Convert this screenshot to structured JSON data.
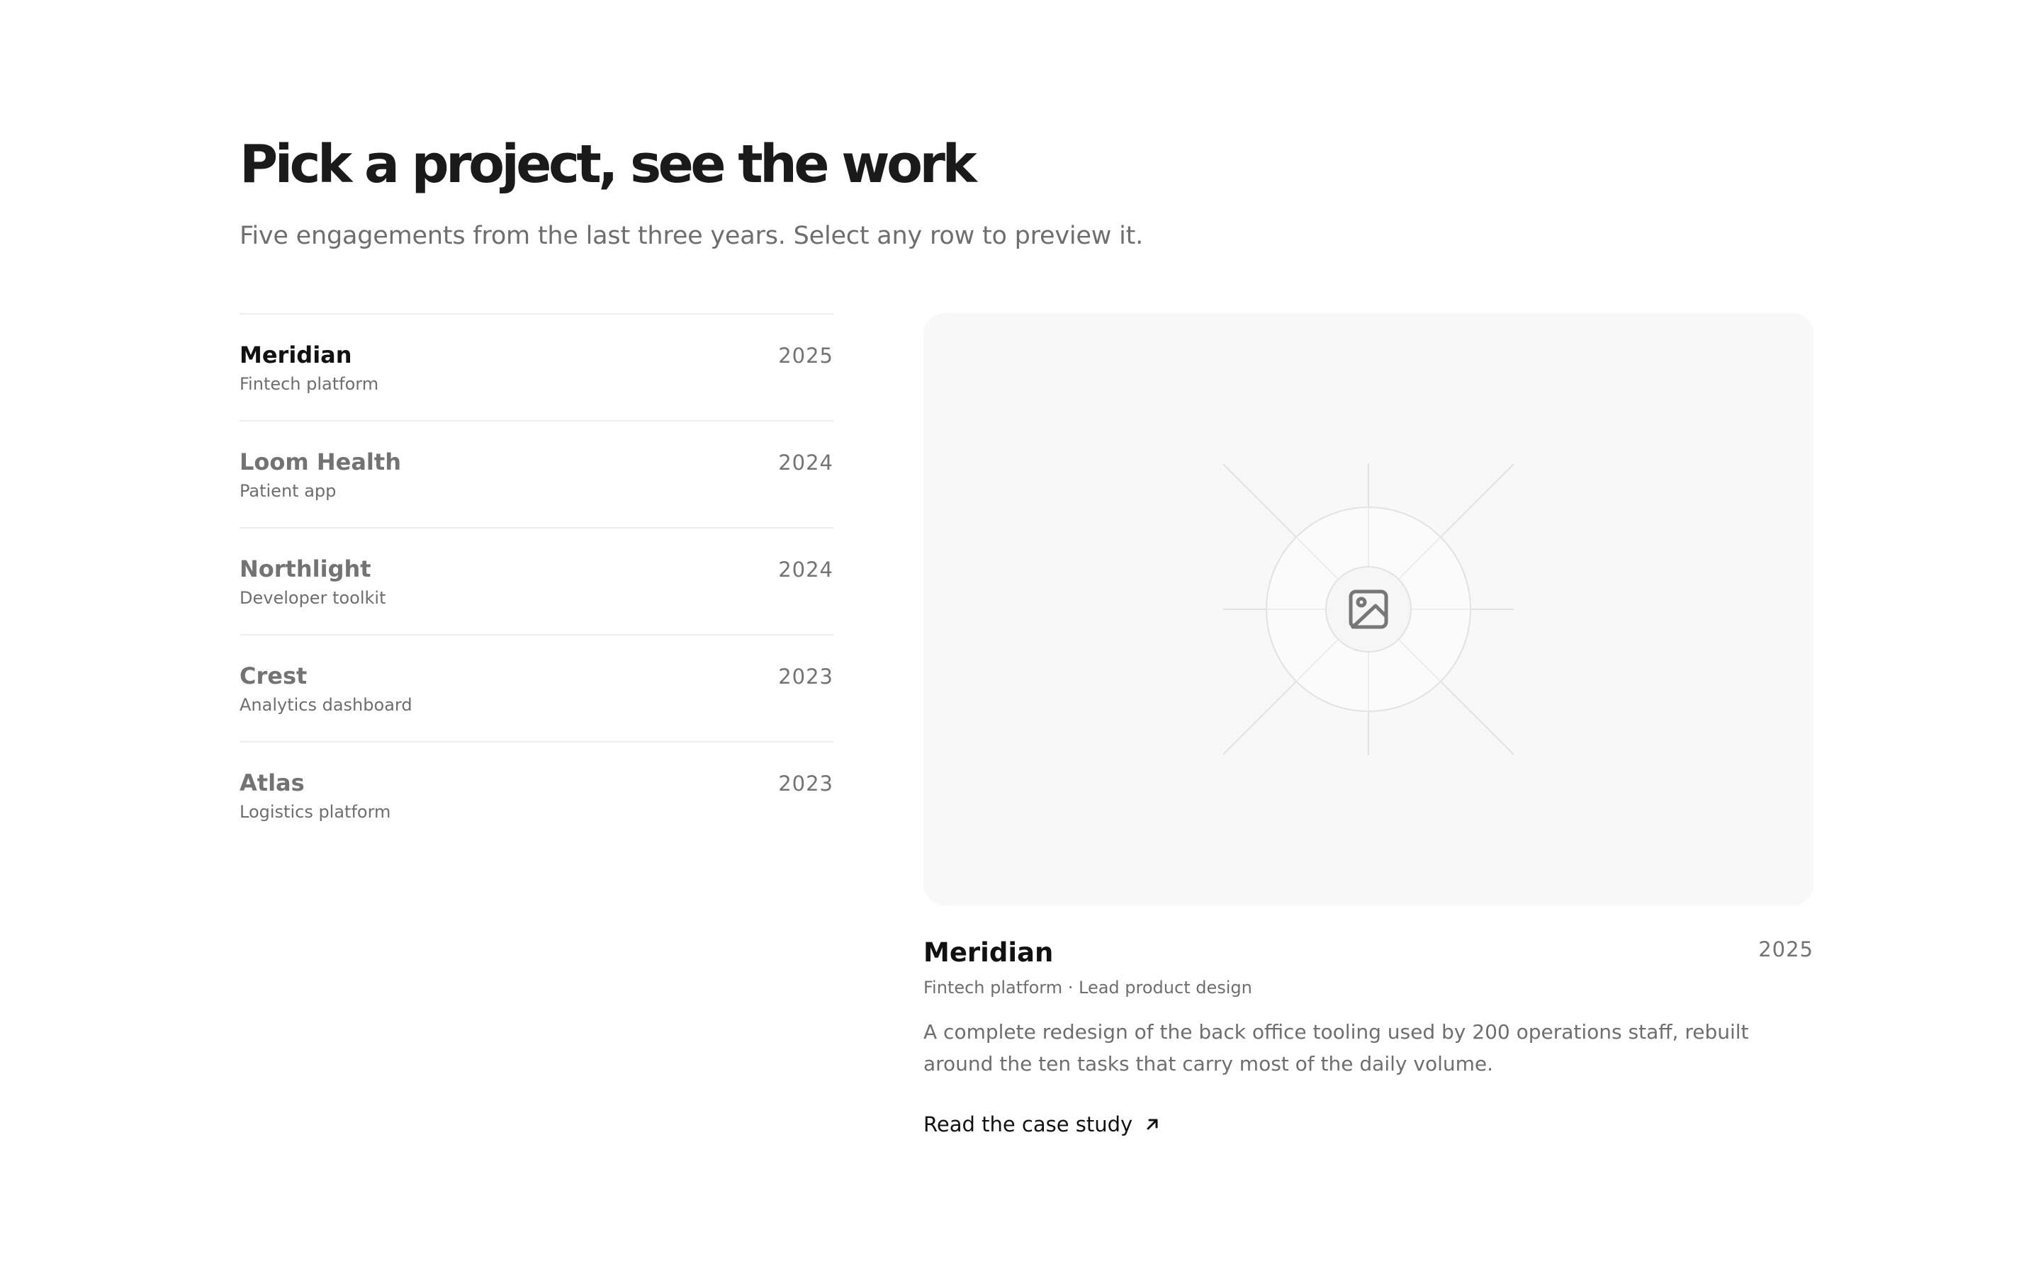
{
  "header": {
    "title": "Pick a project, see the work",
    "subtitle": "Five engagements from the last three years. Select any row to preview it."
  },
  "projects": [
    {
      "name": "Meridian",
      "type": "Fintech platform",
      "year": "2025",
      "active": true
    },
    {
      "name": "Loom Health",
      "type": "Patient app",
      "year": "2024",
      "active": false
    },
    {
      "name": "Northlight",
      "type": "Developer toolkit",
      "year": "2024",
      "active": false
    },
    {
      "name": "Crest",
      "type": "Analytics dashboard",
      "year": "2023",
      "active": false
    },
    {
      "name": "Atlas",
      "type": "Logistics platform",
      "year": "2023",
      "active": false
    }
  ],
  "preview": {
    "icon": "image-icon",
    "name": "Meridian",
    "year": "2025",
    "meta": "Fintech platform · Lead product design",
    "description": "A complete redesign of the back office tooling used by 200 operations staff, rebuilt around the ten tasks that carry most of the daily volume.",
    "link_label": "Read the case study",
    "link_icon": "arrow-up-right-icon"
  },
  "colors": {
    "text_primary": "#111111",
    "text_muted": "#737373",
    "divider": "#eeeeee",
    "preview_bg": "#f8f8f8"
  }
}
